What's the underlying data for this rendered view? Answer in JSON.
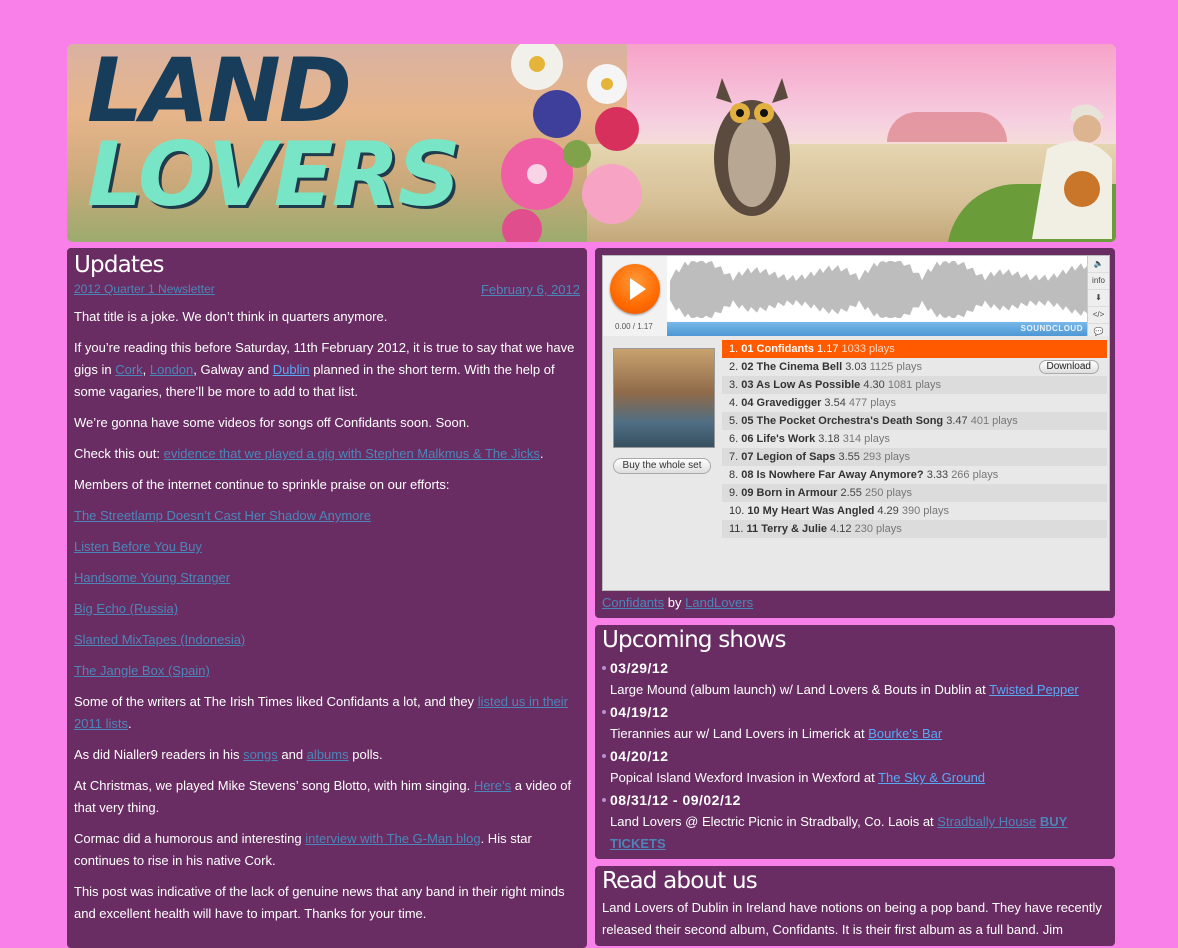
{
  "banner": {
    "title_line1": "LAND",
    "title_line2": "LOVERS"
  },
  "updates": {
    "heading": "Updates",
    "post_title": "2012 Quarter 1 Newsletter",
    "post_date": "February 6, 2012",
    "p1": "That title is a joke. We don’t think in quarters anymore.",
    "p2_a": "If you’re reading this before Saturday, 11th February 2012, it is true to say that we have gigs in ",
    "p2_cork": "Cork",
    "p2_b": ", ",
    "p2_london": "London",
    "p2_c": ", Galway and ",
    "p2_dublin": "Dublin",
    "p2_d": " planned in the short term. With the help of some vagaries, there’ll be more to add to that list.",
    "p3": "We’re gonna have some videos for songs off Confidants soon. Soon.",
    "p4_a": "Check this out: ",
    "p4_link": "evidence that we played a gig with Stephen Malkmus & The Jicks",
    "p4_b": ".",
    "p5": "Members of the internet continue to sprinkle praise on our efforts:",
    "praise_links": [
      "The Streetlamp Doesn’t Cast Her Shadow Anymore",
      "Listen Before You Buy",
      "Handsome Young Stranger",
      "Big Echo (Russia)",
      "Slanted MixTapes (Indonesia)",
      "The Jangle Box (Spain)"
    ],
    "p6_a": "Some of the writers at The Irish Times liked Confidants a lot, and they ",
    "p6_link": "listed us in their 2011 lists",
    "p6_b": ".",
    "p7_a": "As did Nialler9 readers in his ",
    "p7_songs": "songs",
    "p7_b": " and ",
    "p7_albums": "albums",
    "p7_c": " polls.",
    "p8_a": "At Christmas, we played Mike Stevens’ song Blotto, with him singing. ",
    "p8_link": "Here’s",
    "p8_b": " a video of that very thing.",
    "p9_a": "Cormac did a humorous and interesting ",
    "p9_link": "interview with The G-Man blog",
    "p9_b": ". His star continues to rise in his native Cork.",
    "p10": "This post was indicative of the lack of genuine news that any band in their right minds and excellent health will have to impart. Thanks for your time."
  },
  "player": {
    "time": "0.00 / 1.17",
    "brand": "SOUNDCLOUD",
    "side_buttons": [
      "info"
    ],
    "buy_set": "Buy the whole set",
    "download": "Download",
    "album_link": "Confidants",
    "by": "by",
    "artist_link": "LandLovers",
    "tracks": [
      {
        "num": "1.",
        "name": "01 Confidants",
        "dur": "1.17",
        "plays": "1033 plays"
      },
      {
        "num": "2.",
        "name": "02 The Cinema Bell",
        "dur": "3.03",
        "plays": "1125 plays"
      },
      {
        "num": "3.",
        "name": "03 As Low As Possible",
        "dur": "4.30",
        "plays": "1081 plays"
      },
      {
        "num": "4.",
        "name": "04 Gravedigger",
        "dur": "3.54",
        "plays": "477 plays"
      },
      {
        "num": "5.",
        "name": "05 The Pocket Orchestra's Death Song",
        "dur": "3.47",
        "plays": "401 plays"
      },
      {
        "num": "6.",
        "name": "06 Life's Work",
        "dur": "3.18",
        "plays": "314 plays"
      },
      {
        "num": "7.",
        "name": "07 Legion of Saps",
        "dur": "3.55",
        "plays": "293 plays"
      },
      {
        "num": "8.",
        "name": "08 Is Nowhere Far Away Anymore?",
        "dur": "3.33",
        "plays": "266 plays"
      },
      {
        "num": "9.",
        "name": "09 Born in Armour",
        "dur": "2.55",
        "plays": "250 plays"
      },
      {
        "num": "10.",
        "name": "10 My Heart Was Angled",
        "dur": "4.29",
        "plays": "390 plays"
      },
      {
        "num": "11.",
        "name": "11 Terry & Julie",
        "dur": "4.12",
        "plays": "230 plays"
      }
    ]
  },
  "shows": {
    "heading": "Upcoming shows",
    "items": [
      {
        "date": "03/29/12",
        "desc": "Large Mound (album launch) w/ Land Lovers & Bouts in Dublin at ",
        "venue": "Twisted Pepper"
      },
      {
        "date": "04/19/12",
        "desc": "Tierannies aur w/ Land Lovers in Limerick at ",
        "venue": "Bourke's Bar"
      },
      {
        "date": "04/20/12",
        "desc": "Popical Island Wexford Invasion in Wexford at ",
        "venue": "The Sky & Ground"
      },
      {
        "date": "08/31/12 - 09/02/12",
        "desc": "Land Lovers @ Electric Picnic in Stradbally, Co. Laois at ",
        "venue": "Stradbally House",
        "extra": "BUY TICKETS"
      }
    ]
  },
  "about": {
    "heading": "Read about us",
    "text": "Land Lovers of Dublin in Ireland have notions on being a pop band. They have recently released their second album, Confidants. It is their first album as a full band. Jim"
  },
  "colors": {
    "page_bg": "#f97fe9",
    "panel_bg": "#6a2d63",
    "accent_orange": "#ff5a00",
    "link_blue": "#4a8fd0"
  }
}
